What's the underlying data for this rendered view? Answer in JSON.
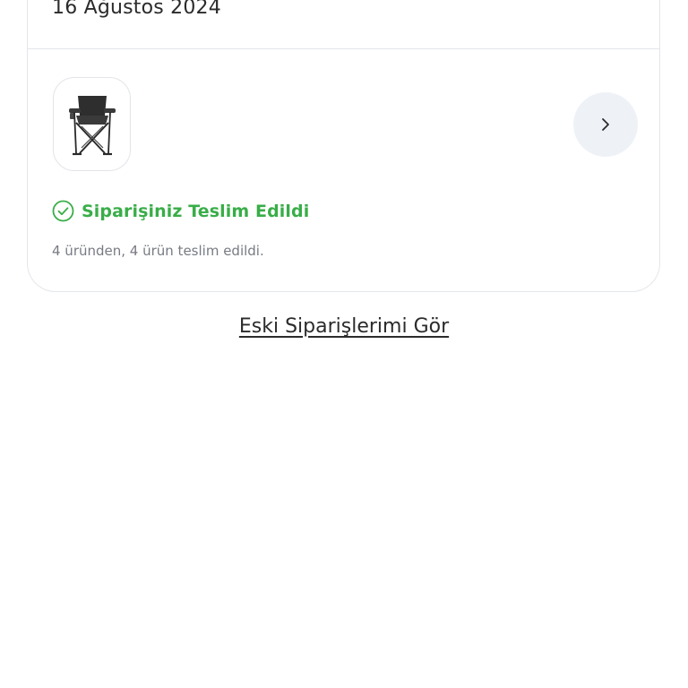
{
  "order": {
    "date": "16 Ağustos 2024",
    "product_image_icon": "folding-camp-chair",
    "status_icon": "check-circle-icon",
    "status_text": "Siparişiniz Teslim Edildi",
    "summary": "4 üründen, 4 ürün teslim edildi."
  },
  "links": {
    "old_orders": "Eski Siparişlerimi Gör"
  },
  "colors": {
    "status_green": "#39ad48",
    "chevron_bg": "#eef2f7",
    "border": "#e4e6ea"
  }
}
